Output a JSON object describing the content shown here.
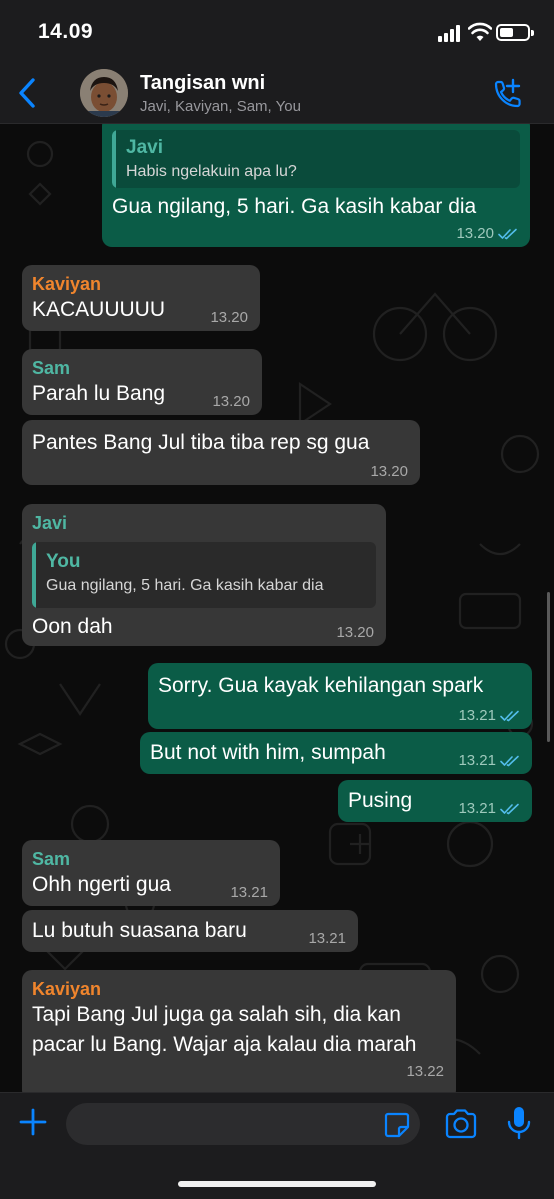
{
  "status_bar": {
    "time": "14.09"
  },
  "header": {
    "title": "Tangisan wni",
    "members": "Javi, Kaviyan, Sam, You"
  },
  "colors": {
    "accent": "#0a84ff",
    "outgoing_bubble": "#0b5c47",
    "incoming_bubble": "#373737",
    "sender_javi": "#4fb7a3",
    "sender_kaviyan": "#f0852d",
    "sender_sam": "#4fb7a3"
  },
  "messages": [
    {
      "direction": "out",
      "quote_name": "Javi",
      "quote_text": "Habis ngelakuin apa lu?",
      "text": "Gua ngilang, 5 hari. Ga kasih kabar dia",
      "time": "13.20",
      "read": true
    },
    {
      "direction": "in",
      "sender": "Kaviyan",
      "text": "KACAUUUUU",
      "time": "13.20"
    },
    {
      "direction": "in",
      "sender": "Sam",
      "text": "Parah lu Bang",
      "time": "13.20"
    },
    {
      "direction": "in",
      "text": "Pantes Bang Jul tiba tiba rep sg gua",
      "time": "13.20"
    },
    {
      "direction": "in",
      "sender": "Javi",
      "quote_name": "You",
      "quote_text": "Gua ngilang, 5 hari. Ga kasih kabar dia",
      "text": "Oon dah",
      "time": "13.20"
    },
    {
      "direction": "out",
      "text": "Sorry. Gua kayak kehilangan spark",
      "time": "13.21",
      "read": true
    },
    {
      "direction": "out",
      "text": "But not with him, sumpah",
      "time": "13.21",
      "read": true
    },
    {
      "direction": "out",
      "text": "Pusing",
      "time": "13.21",
      "read": true
    },
    {
      "direction": "in",
      "sender": "Sam",
      "text": "Ohh ngerti gua",
      "time": "13.21"
    },
    {
      "direction": "in",
      "text": "Lu butuh suasana baru",
      "time": "13.21"
    },
    {
      "direction": "in",
      "sender": "Kaviyan",
      "text": "Tapi Bang Jul juga ga salah sih, dia kan pacar lu Bang. Wajar aja kalau dia marah",
      "time": "13.22"
    }
  ],
  "input": {
    "value": "",
    "placeholder": ""
  }
}
